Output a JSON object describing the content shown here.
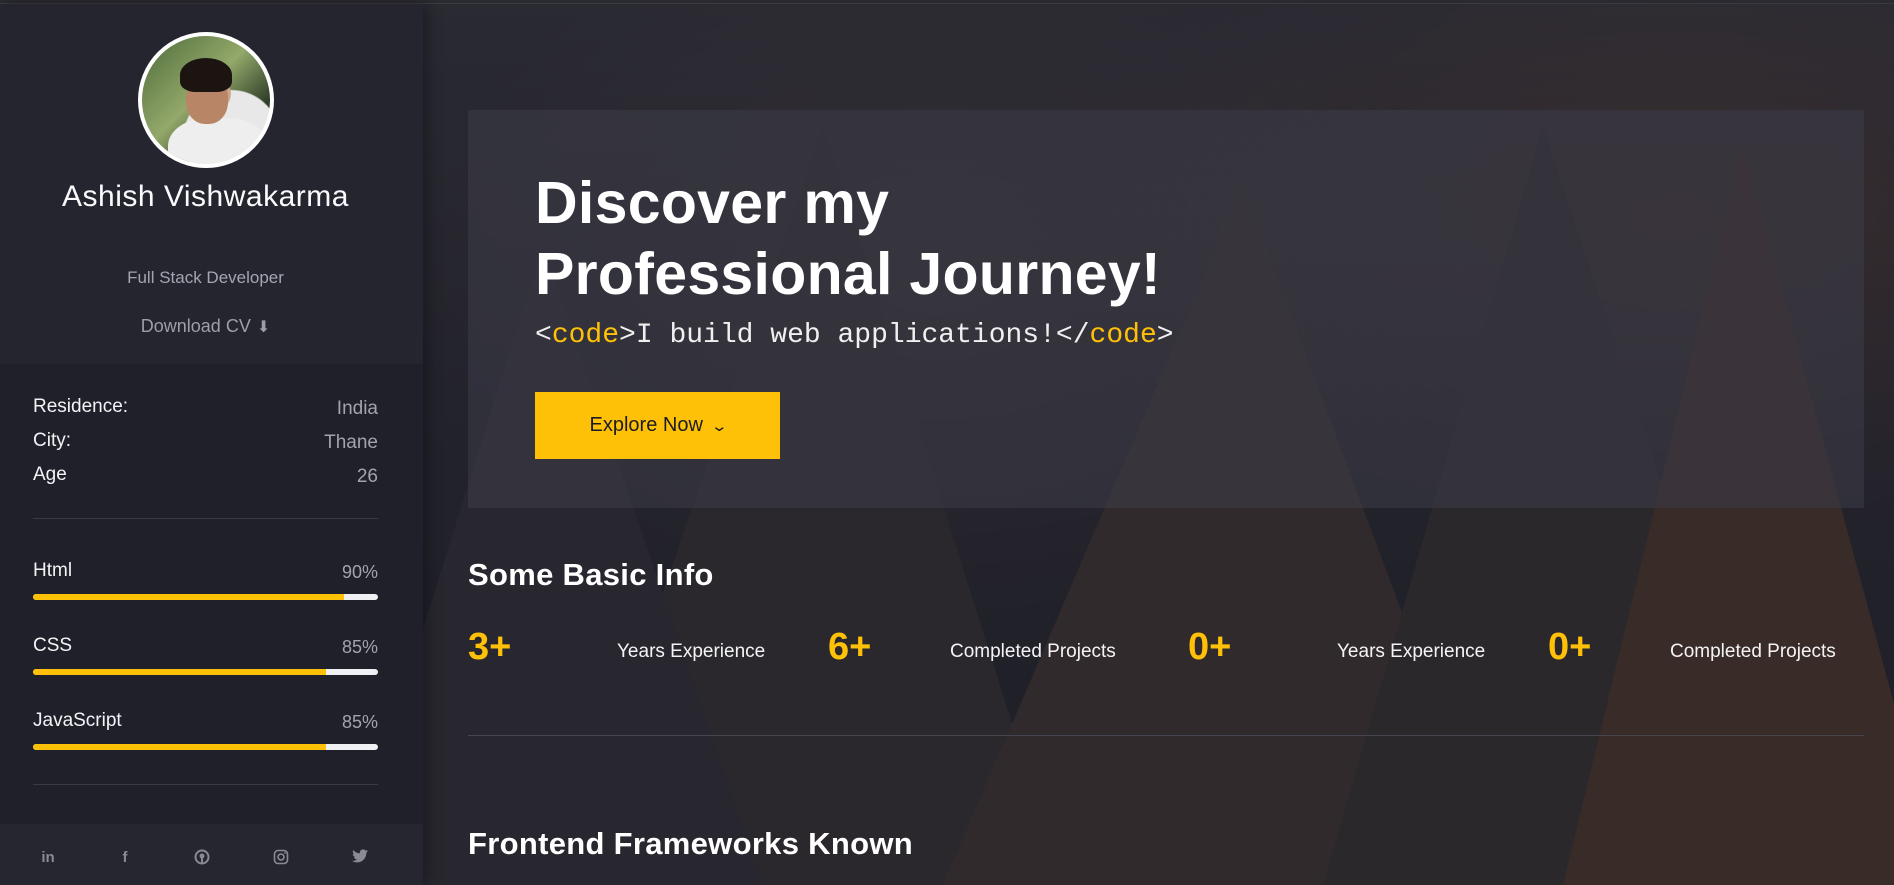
{
  "profile": {
    "name": "Ashish Vishwakarma",
    "role": "Full Stack Developer",
    "download_label": "Download CV",
    "download_icon": "download-icon"
  },
  "info": [
    {
      "key": "Residence:",
      "value": "India"
    },
    {
      "key": "City:",
      "value": "Thane"
    },
    {
      "key": "Age",
      "value": "26"
    }
  ],
  "skills": [
    {
      "name": "Html",
      "value": "90%",
      "level": 0.9
    },
    {
      "name": "CSS",
      "value": "85%",
      "level": 0.85
    },
    {
      "name": "JavaScript",
      "value": "85%",
      "level": 0.85
    }
  ],
  "social": [
    "linkedin-icon",
    "facebook-icon",
    "github-icon",
    "instagram-icon",
    "twitter-icon"
  ],
  "hero": {
    "title_line1": "Discover my",
    "title_line2": "Professional Journey!",
    "code_open_lt": "<",
    "code_open_tag": "code",
    "code_open_gt": ">",
    "code_text": "I build web applications!",
    "code_close_lt": "</",
    "code_close_tag": "code",
    "code_close_gt": ">",
    "button_label": "Explore Now"
  },
  "basic_info": {
    "title": "Some Basic Info",
    "stats": [
      {
        "number": "3+",
        "label": "Years Experience"
      },
      {
        "number": "6+",
        "label": "Completed Projects"
      },
      {
        "number": "0+",
        "label": "Years Experience"
      },
      {
        "number": "0+",
        "label": "Completed Projects"
      }
    ]
  },
  "frameworks": {
    "title": "Frontend Frameworks Known"
  },
  "colors": {
    "accent": "#ffc107",
    "sidebar": "#20202a",
    "background": "#1e1e26"
  }
}
